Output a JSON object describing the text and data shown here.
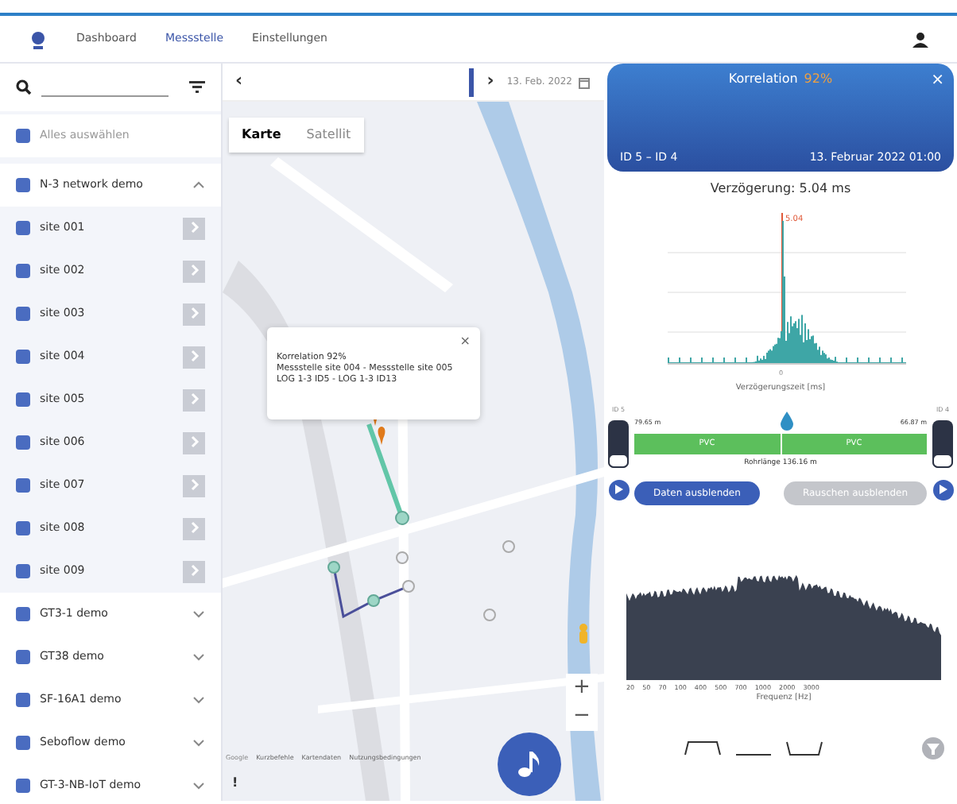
{
  "nav": {
    "items": [
      {
        "label": "Dashboard",
        "selected": false
      },
      {
        "label": "Messstelle",
        "selected": true
      },
      {
        "label": "Einstellungen",
        "selected": false
      }
    ]
  },
  "sidebar": {
    "select_all": {
      "label": "Alles auswählen",
      "checked": true
    },
    "groups": [
      {
        "label": "N-3 network demo",
        "checked": true,
        "expanded": true,
        "children": [
          {
            "label": "site 001",
            "checked": true
          },
          {
            "label": "site 002",
            "checked": true
          },
          {
            "label": "site 003",
            "checked": true
          },
          {
            "label": "site 004",
            "checked": true
          },
          {
            "label": "site 005",
            "checked": true
          },
          {
            "label": "site 006",
            "checked": true
          },
          {
            "label": "site 007",
            "checked": true
          },
          {
            "label": "site 008",
            "checked": true
          },
          {
            "label": "site 009",
            "checked": true
          }
        ]
      },
      {
        "label": "GT3-1 demo",
        "checked": true,
        "expanded": false
      },
      {
        "label": "GT38 demo",
        "checked": true,
        "expanded": false
      },
      {
        "label": "SF-16A1 demo",
        "checked": true,
        "expanded": false
      },
      {
        "label": "Seboflow demo",
        "checked": true,
        "expanded": false
      },
      {
        "label": "GT-3-NB-IoT demo",
        "checked": true,
        "expanded": false
      }
    ]
  },
  "map": {
    "prev": "‹",
    "next": "›",
    "date": "13. Feb. 2022",
    "tabs": [
      {
        "label": "Karte",
        "selected": true
      },
      {
        "label": "Satellit",
        "selected": false
      }
    ],
    "popup": {
      "close": "×",
      "lines": [
        "Korrelation 92%",
        "Messstelle site 004 - Messstelle site 005",
        "LOG 1-3 ID5 - LOG 1-3 ID13"
      ]
    },
    "zoom_in": "+",
    "zoom_out": "−",
    "attribution": [
      "Google",
      "Kurzbefehle",
      "Kartendaten",
      "Nutzungsbedingungen"
    ],
    "exclamation": "!"
  },
  "panel": {
    "title": "Korrelation",
    "percent": "92%",
    "close": "×",
    "ids": "ID 5 – ID 4",
    "datetime": "13. Februar 2022 01:00",
    "delay": "Verzögerung: 5.04 ms",
    "peak_label": "5.04",
    "chart_xlabel": "Verzögerungszeit [ms]",
    "chart_zero": "0",
    "pipe": {
      "left_id": "ID 5",
      "right_id": "ID 4",
      "left_distance": "79.65 m",
      "right_distance": "66.87 m",
      "leak": {
        "level": 0.52
      },
      "segments": [
        "PVC",
        "PVC"
      ],
      "length": "Rohrlänge 136.16 m"
    },
    "buttons": [
      {
        "label": "Daten ausblenden",
        "disabled": false
      },
      {
        "label": "Rauschen ausblenden",
        "disabled": true
      }
    ],
    "spectrum": {
      "ticks": [
        "20",
        "50",
        "70",
        "100",
        "400",
        "500",
        "700",
        "1000",
        "2000",
        "3000"
      ],
      "xlabel": "Frequenz [Hz]"
    }
  }
}
